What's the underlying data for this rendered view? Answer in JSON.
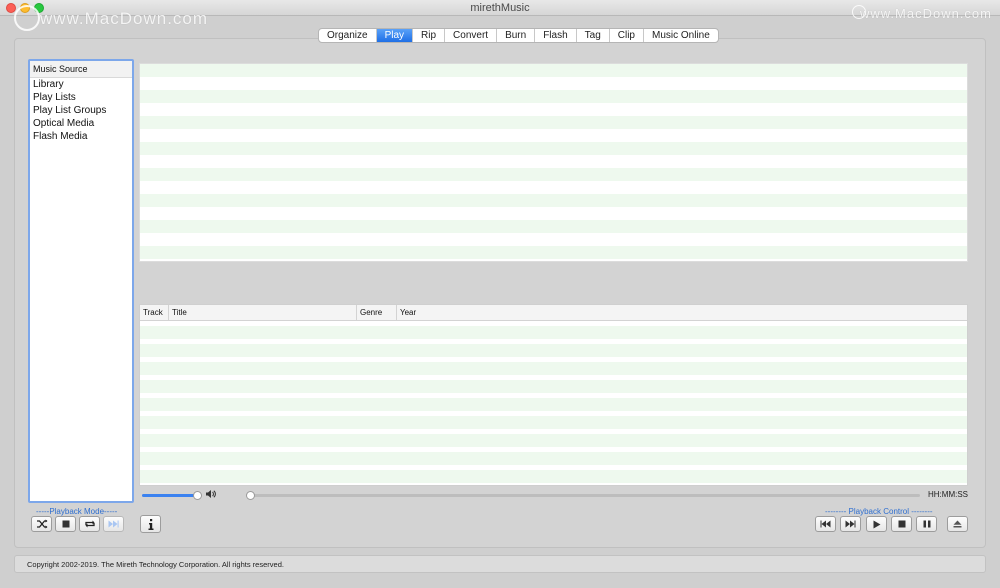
{
  "window": {
    "title": "mirethMusic",
    "watermark_left": "www.MacDown.com",
    "watermark_right": "www.MacDown.com"
  },
  "tabs": [
    {
      "label": "Organize"
    },
    {
      "label": "Play",
      "active": true
    },
    {
      "label": "Rip"
    },
    {
      "label": "Convert"
    },
    {
      "label": "Burn"
    },
    {
      "label": "Flash"
    },
    {
      "label": "Tag"
    },
    {
      "label": "Clip"
    },
    {
      "label": "Music Online"
    }
  ],
  "source": {
    "header": "Music Source",
    "items": [
      "Library",
      "Play Lists",
      "Play List Groups",
      "Optical Media",
      "Flash Media"
    ]
  },
  "track_table": {
    "columns": [
      "Track",
      "Title",
      "Genre",
      "Year"
    ]
  },
  "playback": {
    "volume": 1.0,
    "position": 0.0,
    "time_label": "HH:MM:SS",
    "mode_label": "-----Playback Mode-----",
    "control_label": "-------- Playback Control --------"
  },
  "icons": {
    "mode": [
      "shuffle-icon",
      "stop-square-icon",
      "repeat-icon",
      "fast-forward-icon"
    ],
    "info": "info-icon",
    "control": [
      "skip-back-icon",
      "skip-forward-icon",
      "play-icon",
      "stop-icon",
      "pause-icon",
      "eject-icon"
    ]
  },
  "colors": {
    "accent": "#3b82f0",
    "row_stripe": "#eef9ee"
  },
  "status": {
    "copyright": "Copyright 2002-2019.  The Mireth Technology Corporation.  All rights reserved."
  }
}
